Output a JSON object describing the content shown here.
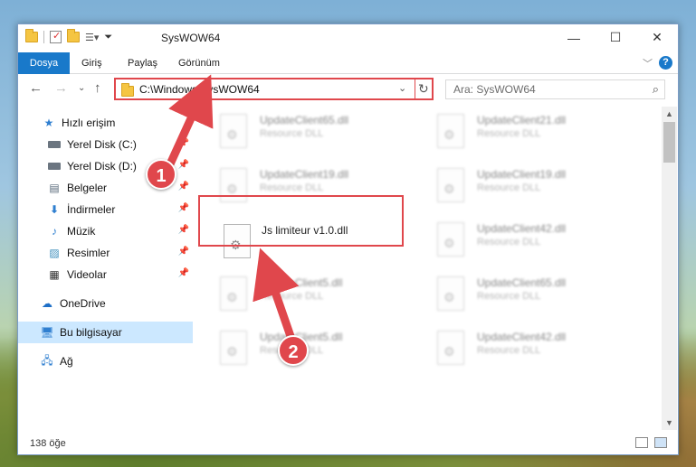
{
  "window": {
    "title": "SysWOW64",
    "minimize": "—",
    "maximize": "☐",
    "close": "✕"
  },
  "ribbon": {
    "tabs": [
      "Dosya",
      "Giriş",
      "Paylaş",
      "Görünüm"
    ],
    "help": "?"
  },
  "navigation": {
    "address": "C:\\Windows\\SysWOW64",
    "search_placeholder": "Ara: SysWOW64"
  },
  "sidebar": {
    "items": [
      {
        "label": "Hızlı erişim",
        "icon": "star-icon"
      },
      {
        "label": "Yerel Disk (C:)",
        "icon": "drive-icon",
        "pinned": true
      },
      {
        "label": "Yerel Disk (D:)",
        "icon": "drive-icon",
        "pinned": true
      },
      {
        "label": "Belgeler",
        "icon": "documents-icon",
        "pinned": true
      },
      {
        "label": "İndirmeler",
        "icon": "download-icon",
        "pinned": true
      },
      {
        "label": "Müzik",
        "icon": "music-icon",
        "pinned": true
      },
      {
        "label": "Resimler",
        "icon": "pictures-icon",
        "pinned": true
      },
      {
        "label": "Videolar",
        "icon": "videos-icon",
        "pinned": true
      },
      {
        "label": "OneDrive",
        "icon": "cloud-icon"
      },
      {
        "label": "Bu bilgisayar",
        "icon": "computer-icon",
        "selected": true
      },
      {
        "label": "Ağ",
        "icon": "network-icon"
      }
    ]
  },
  "files": [
    {
      "name": "UpdateClient65.dll",
      "type": "Resource DLL"
    },
    {
      "name": "UpdateClient21.dll",
      "type": "Resource DLL"
    },
    {
      "name": "UpdateClient19.dll",
      "type": "Resource DLL"
    },
    {
      "name": "UpdateClient19.dll",
      "type": "Resource DLL"
    },
    {
      "name": "Js limiteur v1.0.dll",
      "type": ""
    },
    {
      "name": "UpdateClient42.dll",
      "type": "Resource DLL"
    },
    {
      "name": "UpdateClient5.dll",
      "type": "Resource DLL"
    },
    {
      "name": "UpdateClient65.dll",
      "type": "Resource DLL"
    },
    {
      "name": "UpdateClient5.dll",
      "type": "Resource DLL"
    },
    {
      "name": "UpdateClient42.dll",
      "type": "Resource DLL"
    }
  ],
  "status": {
    "count": "138 öğe"
  },
  "annotations": {
    "step1": "1",
    "step2": "2",
    "color": "#e0474c"
  }
}
